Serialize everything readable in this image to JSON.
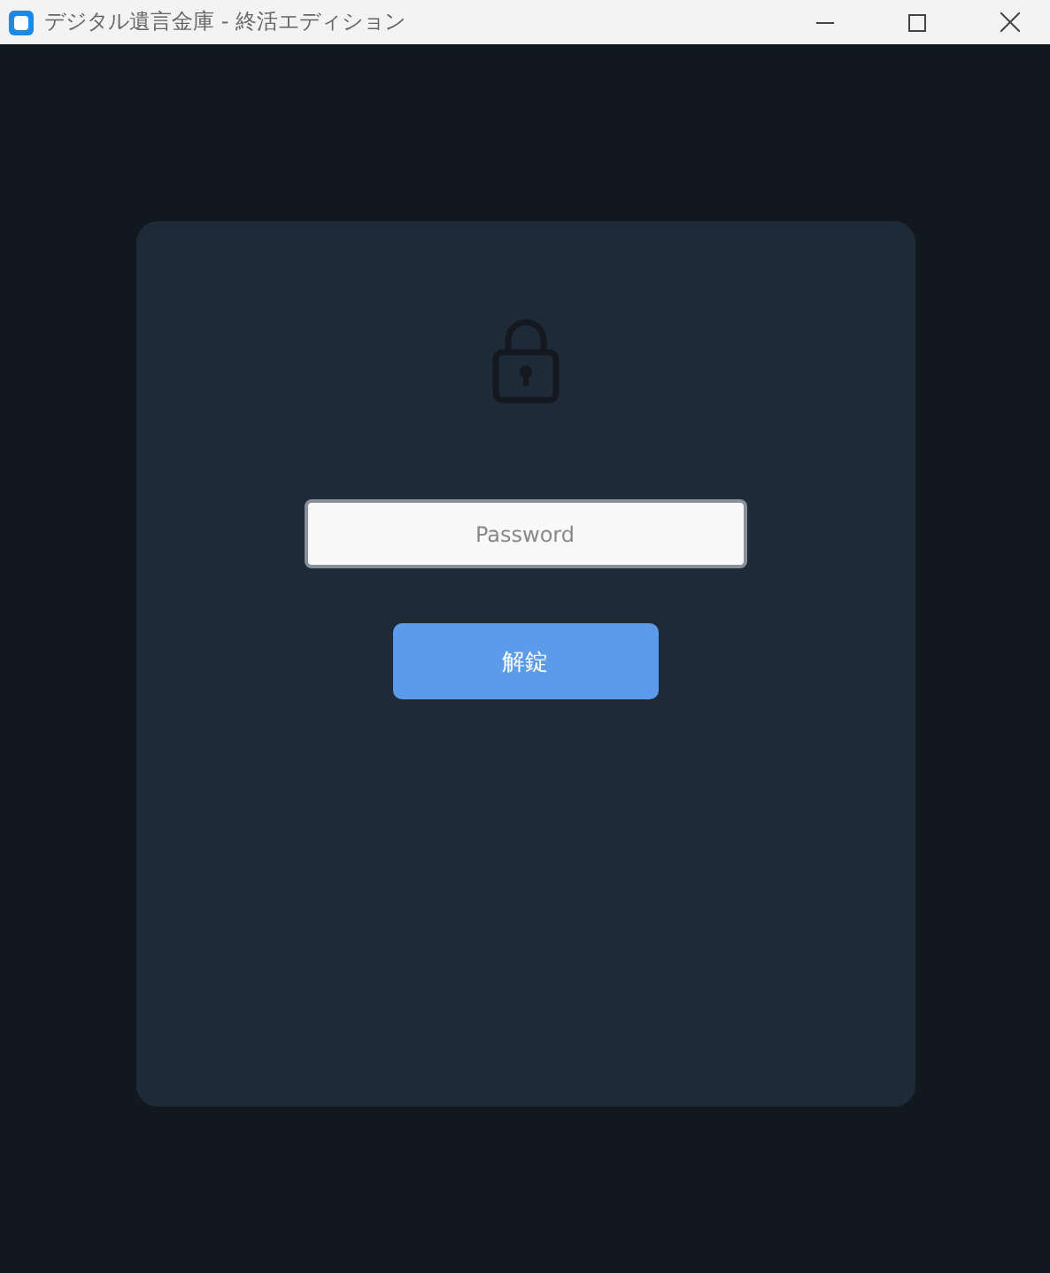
{
  "window": {
    "title": "デジタル遺言金庫 - 終活エディション"
  },
  "password": {
    "placeholder": "Password"
  },
  "unlock_button": {
    "label": "解錠"
  }
}
